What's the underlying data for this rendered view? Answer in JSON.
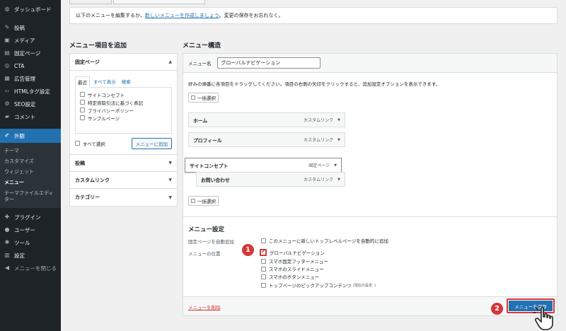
{
  "sidebar": {
    "items": [
      {
        "icon": "dashboard-icon",
        "glyph": "◍",
        "label": "ダッシュボード"
      },
      {
        "icon": "pin-icon",
        "glyph": "✎",
        "label": "投稿"
      },
      {
        "icon": "media-icon",
        "glyph": "▣",
        "label": "メディア"
      },
      {
        "icon": "page-icon",
        "glyph": "▤",
        "label": "固定ページ"
      },
      {
        "icon": "cta-icon",
        "glyph": "◎",
        "label": "CTA"
      },
      {
        "icon": "ad-icon",
        "glyph": "▦",
        "label": "広告管理"
      },
      {
        "icon": "code-icon",
        "glyph": "‹›",
        "label": "HTMLタグ設定"
      },
      {
        "icon": "seo-icon",
        "glyph": "⚙",
        "label": "SEO設定"
      },
      {
        "icon": "comment-icon",
        "glyph": "▰",
        "label": "コメント"
      },
      {
        "icon": "appearance-icon",
        "glyph": "✐",
        "label": "外観"
      }
    ],
    "submenu": [
      "テーマ",
      "カスタマイズ",
      "ウィジェット",
      "メニュー",
      "テーマファイルエディター"
    ],
    "items_after": [
      {
        "icon": "plugin-icon",
        "glyph": "✚",
        "label": "プラグイン"
      },
      {
        "icon": "user-icon",
        "glyph": "●",
        "label": "ユーザー"
      },
      {
        "icon": "tool-icon",
        "glyph": "✱",
        "label": "ツール"
      },
      {
        "icon": "settings-icon",
        "glyph": "▥",
        "label": "設定"
      },
      {
        "icon": "collapse-icon",
        "glyph": "◀",
        "label": "メニューを閉じる"
      }
    ]
  },
  "notice": {
    "before": "以下のメニューを編集するか、",
    "link": "新しいメニューを作成しましょう",
    "after": "。変更の保存をお忘れなく。"
  },
  "add_items": {
    "title": "メニュー項目を追加",
    "pages_heading": "固定ページ",
    "tabs": [
      "最近",
      "すべて表示",
      "検索"
    ],
    "pages": [
      "サイトコンセプト",
      "特定商取引法に基づく表記",
      "プライバシーポリシー",
      "サンプルページ"
    ],
    "select_all": "すべて選択",
    "add_button": "メニューに追加",
    "sections": [
      "投稿",
      "カスタムリンク",
      "カテゴリー"
    ]
  },
  "structure": {
    "title": "メニュー構造",
    "name_label": "メニュー名",
    "name_value": "グローバルナビゲーション",
    "instructions": "好みの順番に各項目をドラッグしてください。項目の右側の矢印をクリックすると、追加設定オプションを表示できます。",
    "bulk_select": "一括選択",
    "items": [
      {
        "label": "ホーム",
        "type": "カスタムリンク"
      },
      {
        "label": "プロフィール",
        "type": "カスタムリンク"
      },
      {
        "label": "サイトコンセプト",
        "type": "固定ページ"
      },
      {
        "label": "お問い合わせ",
        "type": "カスタムリンク"
      }
    ]
  },
  "settings": {
    "title": "メニュー設定",
    "auto_add_label": "固定ページを自動追加",
    "auto_add_option": "このメニューに新しいトップレベルページを自動的に追加",
    "location_label": "メニューの位置",
    "locations": [
      "グローバルナビゲーション",
      "スマホ固定フッターメニュー",
      "スマホのスライドメニュー",
      "スマホのボタンメニュー",
      "トップページのピックアップコンテンツ"
    ],
    "location_note": "(現在の設定: )",
    "delete_link": "メニューを削除",
    "save_button": "メニューを保存"
  },
  "badges": [
    "1",
    "2"
  ],
  "colors": {
    "accent": "#2271b1",
    "highlight": "#d63638",
    "sidebar": "#1d2327"
  }
}
